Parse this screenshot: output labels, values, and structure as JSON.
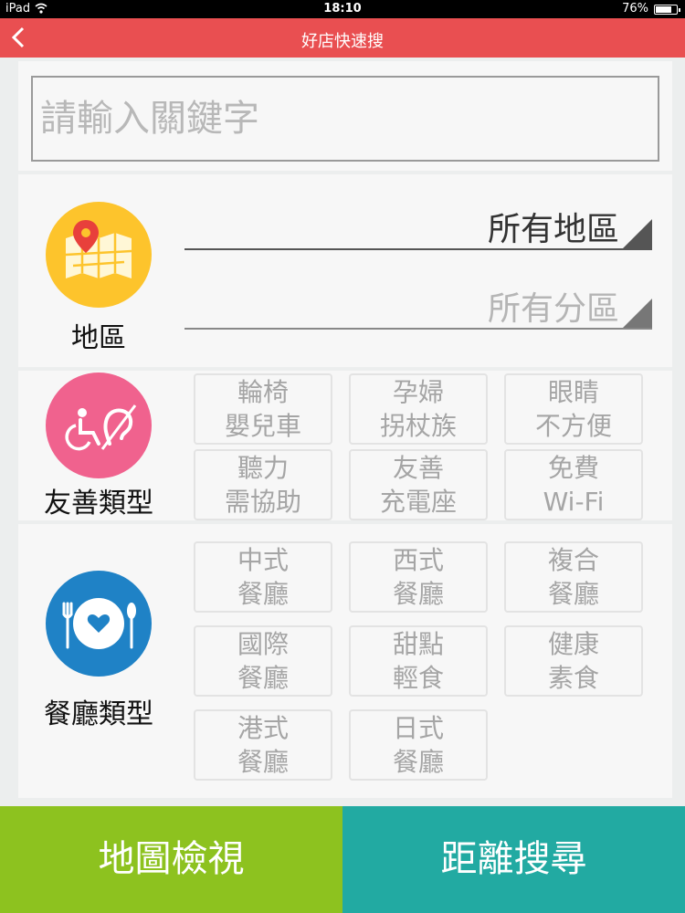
{
  "status_bar": {
    "device": "iPad",
    "time": "18:10",
    "battery": "76%",
    "battery_level": 0.76
  },
  "nav": {
    "title": "好店快速搜",
    "back_icon": "chevron-left-icon"
  },
  "search": {
    "placeholder": "請輸入關鍵字",
    "value": ""
  },
  "area": {
    "label": "地區",
    "icon": "map-pin-icon",
    "region": "所有地區",
    "district": "所有分區"
  },
  "friendly": {
    "label": "友善類型",
    "icon": "accessibility-icon",
    "options": [
      {
        "line1": "輪椅",
        "line2": "嬰兒車"
      },
      {
        "line1": "孕婦",
        "line2": "拐杖族"
      },
      {
        "line1": "眼睛",
        "line2": "不方便"
      },
      {
        "line1": "聽力",
        "line2": "需協助"
      },
      {
        "line1": "友善",
        "line2": "充電座"
      },
      {
        "line1": "免費",
        "line2": "Wi-Fi"
      }
    ]
  },
  "restaurant": {
    "label": "餐廳類型",
    "icon": "dining-icon",
    "options": [
      {
        "line1": "中式",
        "line2": "餐廳"
      },
      {
        "line1": "西式",
        "line2": "餐廳"
      },
      {
        "line1": "複合",
        "line2": "餐廳"
      },
      {
        "line1": "國際",
        "line2": "餐廳"
      },
      {
        "line1": "甜點",
        "line2": "輕食"
      },
      {
        "line1": "健康",
        "line2": "素食"
      },
      {
        "line1": "港式",
        "line2": "餐廳"
      },
      {
        "line1": "日式",
        "line2": "餐廳"
      }
    ]
  },
  "buttons": {
    "map_view": "地圖檢視",
    "distance_search": "距離搜尋"
  },
  "colors": {
    "nav_bar": "#e94f51",
    "area_circle": "#fdc42c",
    "friendly_circle": "#f0628e",
    "restaurant_circle": "#1f82c6",
    "map_button": "#8dc21f",
    "distance_button": "#22aaa2"
  }
}
